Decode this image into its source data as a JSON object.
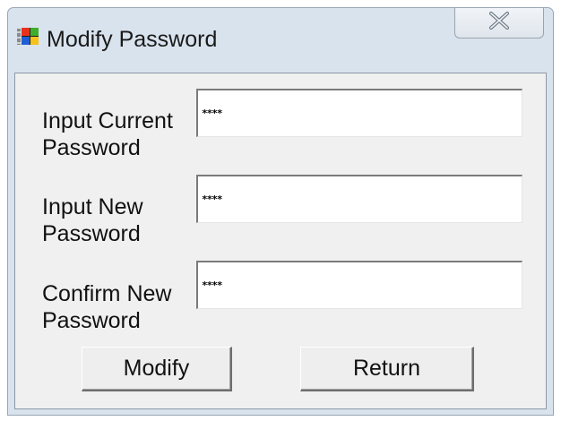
{
  "window": {
    "title": "Modify Password",
    "app_icon": "windows-flag-icon",
    "close_icon": "close-icon"
  },
  "form": {
    "fields": [
      {
        "label_line1": "Input Current",
        "label_line2": "Password",
        "value": "****"
      },
      {
        "label_line1": "Input New",
        "label_line2": "Password",
        "value": "****"
      },
      {
        "label_line1": "Confirm New",
        "label_line2": "Password",
        "value": "****"
      }
    ]
  },
  "buttons": {
    "modify_label": "Modify",
    "return_label": "Return"
  }
}
